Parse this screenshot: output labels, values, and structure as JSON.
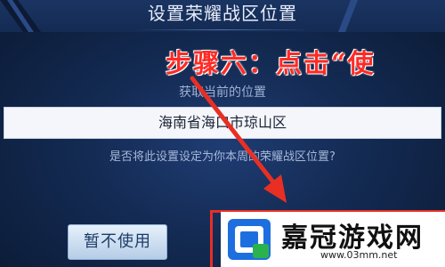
{
  "dialog": {
    "title": "设置荣耀战区位置",
    "sub_label": "获取当前的位置",
    "location_value": "海南省海口市琼山区",
    "question": "是否将此设置设定为你本周的荣耀战区位置?",
    "cancel_label": "暂不使用"
  },
  "annotation": {
    "step_caption": "步骤六：点击“使",
    "caption_color": "#ff2a25",
    "highlight_color": "#e82f24"
  },
  "watermark": {
    "name": "嘉冠游戏网",
    "url": "www.03mm.net"
  },
  "colors": {
    "background": "#132a52",
    "accent": "#8fb1d8"
  }
}
